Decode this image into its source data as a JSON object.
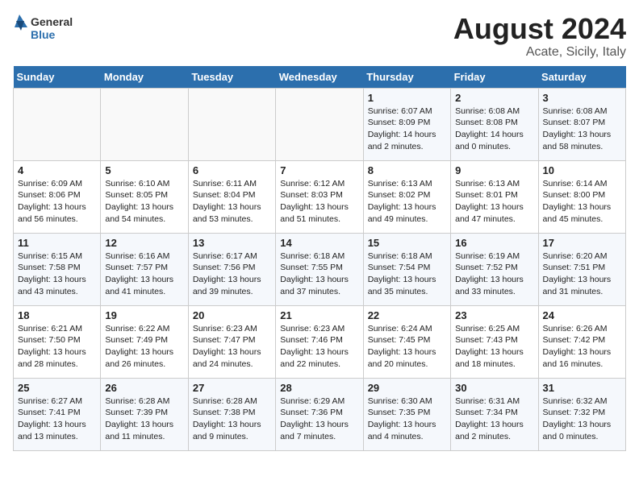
{
  "header": {
    "logo_general": "General",
    "logo_blue": "Blue",
    "month_year": "August 2024",
    "location": "Acate, Sicily, Italy"
  },
  "weekdays": [
    "Sunday",
    "Monday",
    "Tuesday",
    "Wednesday",
    "Thursday",
    "Friday",
    "Saturday"
  ],
  "weeks": [
    [
      {
        "day": "",
        "content": ""
      },
      {
        "day": "",
        "content": ""
      },
      {
        "day": "",
        "content": ""
      },
      {
        "day": "",
        "content": ""
      },
      {
        "day": "1",
        "content": "Sunrise: 6:07 AM\nSunset: 8:09 PM\nDaylight: 14 hours\nand 2 minutes."
      },
      {
        "day": "2",
        "content": "Sunrise: 6:08 AM\nSunset: 8:08 PM\nDaylight: 14 hours\nand 0 minutes."
      },
      {
        "day": "3",
        "content": "Sunrise: 6:08 AM\nSunset: 8:07 PM\nDaylight: 13 hours\nand 58 minutes."
      }
    ],
    [
      {
        "day": "4",
        "content": "Sunrise: 6:09 AM\nSunset: 8:06 PM\nDaylight: 13 hours\nand 56 minutes."
      },
      {
        "day": "5",
        "content": "Sunrise: 6:10 AM\nSunset: 8:05 PM\nDaylight: 13 hours\nand 54 minutes."
      },
      {
        "day": "6",
        "content": "Sunrise: 6:11 AM\nSunset: 8:04 PM\nDaylight: 13 hours\nand 53 minutes."
      },
      {
        "day": "7",
        "content": "Sunrise: 6:12 AM\nSunset: 8:03 PM\nDaylight: 13 hours\nand 51 minutes."
      },
      {
        "day": "8",
        "content": "Sunrise: 6:13 AM\nSunset: 8:02 PM\nDaylight: 13 hours\nand 49 minutes."
      },
      {
        "day": "9",
        "content": "Sunrise: 6:13 AM\nSunset: 8:01 PM\nDaylight: 13 hours\nand 47 minutes."
      },
      {
        "day": "10",
        "content": "Sunrise: 6:14 AM\nSunset: 8:00 PM\nDaylight: 13 hours\nand 45 minutes."
      }
    ],
    [
      {
        "day": "11",
        "content": "Sunrise: 6:15 AM\nSunset: 7:58 PM\nDaylight: 13 hours\nand 43 minutes."
      },
      {
        "day": "12",
        "content": "Sunrise: 6:16 AM\nSunset: 7:57 PM\nDaylight: 13 hours\nand 41 minutes."
      },
      {
        "day": "13",
        "content": "Sunrise: 6:17 AM\nSunset: 7:56 PM\nDaylight: 13 hours\nand 39 minutes."
      },
      {
        "day": "14",
        "content": "Sunrise: 6:18 AM\nSunset: 7:55 PM\nDaylight: 13 hours\nand 37 minutes."
      },
      {
        "day": "15",
        "content": "Sunrise: 6:18 AM\nSunset: 7:54 PM\nDaylight: 13 hours\nand 35 minutes."
      },
      {
        "day": "16",
        "content": "Sunrise: 6:19 AM\nSunset: 7:52 PM\nDaylight: 13 hours\nand 33 minutes."
      },
      {
        "day": "17",
        "content": "Sunrise: 6:20 AM\nSunset: 7:51 PM\nDaylight: 13 hours\nand 31 minutes."
      }
    ],
    [
      {
        "day": "18",
        "content": "Sunrise: 6:21 AM\nSunset: 7:50 PM\nDaylight: 13 hours\nand 28 minutes."
      },
      {
        "day": "19",
        "content": "Sunrise: 6:22 AM\nSunset: 7:49 PM\nDaylight: 13 hours\nand 26 minutes."
      },
      {
        "day": "20",
        "content": "Sunrise: 6:23 AM\nSunset: 7:47 PM\nDaylight: 13 hours\nand 24 minutes."
      },
      {
        "day": "21",
        "content": "Sunrise: 6:23 AM\nSunset: 7:46 PM\nDaylight: 13 hours\nand 22 minutes."
      },
      {
        "day": "22",
        "content": "Sunrise: 6:24 AM\nSunset: 7:45 PM\nDaylight: 13 hours\nand 20 minutes."
      },
      {
        "day": "23",
        "content": "Sunrise: 6:25 AM\nSunset: 7:43 PM\nDaylight: 13 hours\nand 18 minutes."
      },
      {
        "day": "24",
        "content": "Sunrise: 6:26 AM\nSunset: 7:42 PM\nDaylight: 13 hours\nand 16 minutes."
      }
    ],
    [
      {
        "day": "25",
        "content": "Sunrise: 6:27 AM\nSunset: 7:41 PM\nDaylight: 13 hours\nand 13 minutes."
      },
      {
        "day": "26",
        "content": "Sunrise: 6:28 AM\nSunset: 7:39 PM\nDaylight: 13 hours\nand 11 minutes."
      },
      {
        "day": "27",
        "content": "Sunrise: 6:28 AM\nSunset: 7:38 PM\nDaylight: 13 hours\nand 9 minutes."
      },
      {
        "day": "28",
        "content": "Sunrise: 6:29 AM\nSunset: 7:36 PM\nDaylight: 13 hours\nand 7 minutes."
      },
      {
        "day": "29",
        "content": "Sunrise: 6:30 AM\nSunset: 7:35 PM\nDaylight: 13 hours\nand 4 minutes."
      },
      {
        "day": "30",
        "content": "Sunrise: 6:31 AM\nSunset: 7:34 PM\nDaylight: 13 hours\nand 2 minutes."
      },
      {
        "day": "31",
        "content": "Sunrise: 6:32 AM\nSunset: 7:32 PM\nDaylight: 13 hours\nand 0 minutes."
      }
    ]
  ]
}
